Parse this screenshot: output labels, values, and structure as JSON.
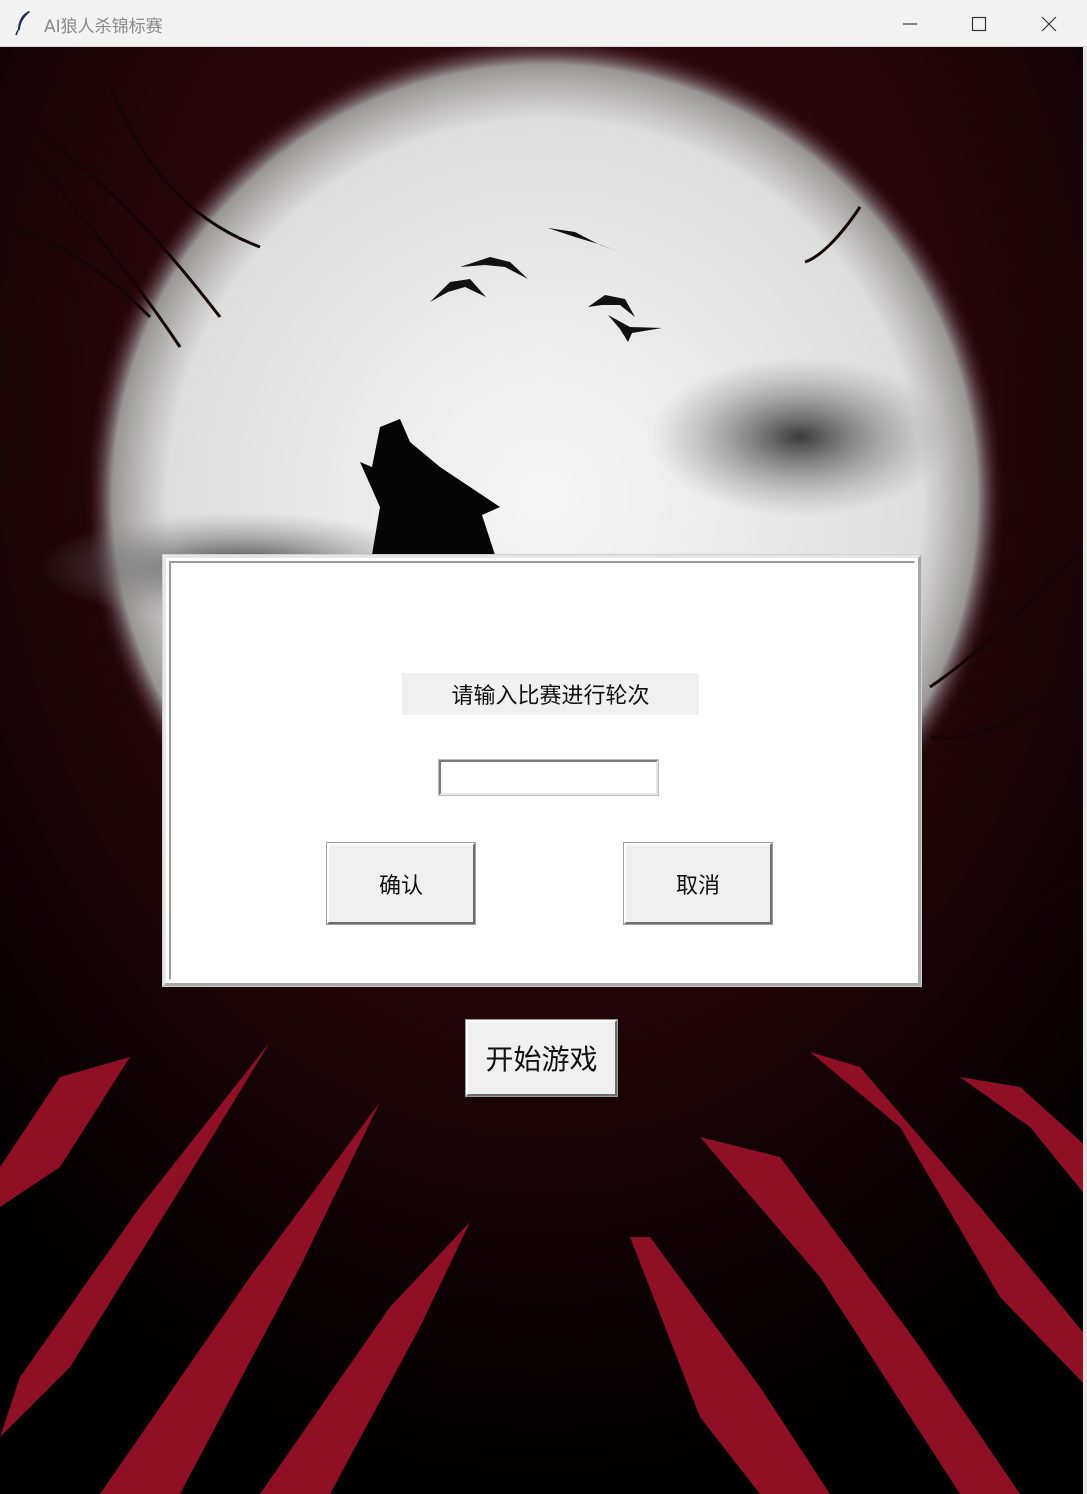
{
  "window": {
    "title": "AI狼人杀锦标赛",
    "icon": "feather-icon",
    "controls": [
      "minimize-icon",
      "maximize-icon",
      "close-icon"
    ]
  },
  "dialog": {
    "prompt": "请输入比赛进行轮次",
    "input_value": "",
    "confirm_label": "确认",
    "cancel_label": "取消"
  },
  "start_button": {
    "label": "开始游戏"
  },
  "colors": {
    "background_dark": "#000000",
    "blood_red": "#8f0f24",
    "moon": "#f4f4f4",
    "dialog_bg": "#ffffff",
    "button_bg": "#f0f0f0"
  }
}
